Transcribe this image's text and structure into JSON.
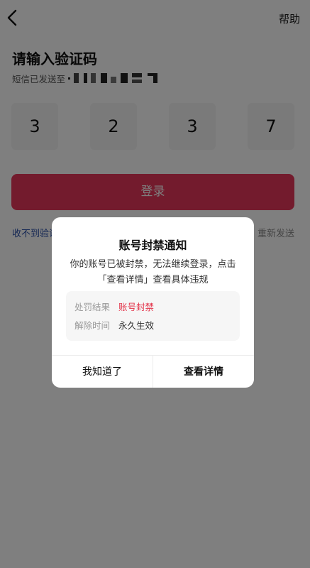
{
  "header": {
    "back_icon": "chevron-left-icon",
    "help_label": "帮助"
  },
  "page": {
    "title": "请输入验证码",
    "sent_label": "短信已发送至"
  },
  "code": {
    "digits": [
      "3",
      "2",
      "3",
      "7"
    ]
  },
  "login_button": "登录",
  "links": {
    "no_code": "收不到验证",
    "resend": "重新发送"
  },
  "dialog": {
    "title": "账号封禁通知",
    "message": "你的账号已被封禁，无法继续登录，点击「查看详情」查看具体违规",
    "info": [
      {
        "key": "处罚结果",
        "value": "账号封禁"
      },
      {
        "key": "解除时间",
        "value": "永久生效"
      }
    ],
    "buttons": {
      "dismiss": "我知道了",
      "details": "查看详情"
    }
  },
  "colors": {
    "login_button": "#e6375a",
    "link": "#2b4fa8",
    "danger": "#e3344a",
    "overlay": "rgba(0,0,0,0.5)"
  }
}
